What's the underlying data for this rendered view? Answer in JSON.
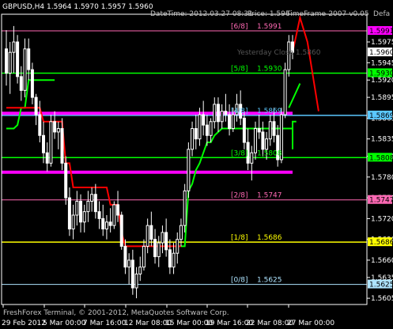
{
  "header": {
    "symbol_line": "GBPUSD,H4  1.5964 1.5970 1.5957 1.5960",
    "datetime": "DateTime: 2012.03.27 08:31",
    "price": "Price: 1.596",
    "indicator": "TimeFrame-2007-v0.05",
    "defa": "Defa"
  },
  "footer": {
    "copyright": "FreshForex Terminal, © 2001-2012, MetaQuotes Software Corp."
  },
  "colors": {
    "background": "#000000",
    "candle": "#ffffff",
    "grid": "#ffffff",
    "magenta": "#ff00ff",
    "green": "#00ff00",
    "yellow": "#ffff00",
    "pink": "#ff69b4",
    "cyan": "#5bc8ff",
    "red": "#ff0000",
    "sky": "#aee4ff",
    "silver": "#c0c0c0"
  },
  "chart_data": {
    "type": "candlestick",
    "symbol": "GBPUSD",
    "timeframe": "H4",
    "ylim": [
      1.5596,
      1.6015
    ],
    "y_ticks": [
      "1.5975",
      "1.5945",
      "1.5920",
      "1.5895",
      "1.5865",
      "1.5835",
      "1.5810",
      "1.5780",
      "1.5750",
      "1.5720",
      "1.5690",
      "1.5660",
      "1.5635",
      "1.5605"
    ],
    "x_ticks": [
      "29 Feb 2012",
      "5 Mar 00:00",
      "7 Mar 16:00",
      "12 Mar 08:00",
      "15 Mar 00:00",
      "19 Mar 16:00",
      "22 Mar 08:00",
      "27 Mar 00:00"
    ],
    "price_tags": [
      {
        "label": "1.5991",
        "color": "#ff00ff",
        "value": 1.5991
      },
      {
        "label": "1.5960",
        "color": "#ffffff",
        "value": 1.596
      },
      {
        "label": "1.5930",
        "color": "#00ff00",
        "value": 1.593
      },
      {
        "label": "1.5869",
        "color": "#5bc8ff",
        "value": 1.5869
      },
      {
        "label": "1.5808",
        "color": "#00ff00",
        "value": 1.5808
      },
      {
        "label": "1.5747",
        "color": "#ff69b4",
        "value": 1.5747
      },
      {
        "label": "1.5686",
        "color": "#ffff00",
        "value": 1.5686
      },
      {
        "label": "1.5625",
        "color": "#aee4ff",
        "value": 1.5625
      }
    ],
    "murrey_levels": [
      {
        "name": "[6/8]",
        "value": 1.5991,
        "value_label": "1.5991",
        "color": "#ff69b4",
        "width": 1
      },
      {
        "name": "[5/8]",
        "value": 1.593,
        "value_label": "1.5930",
        "color": "#00ff00",
        "width": 1.5
      },
      {
        "name": "[4/8]",
        "value": 1.5869,
        "value_label": "1.5869",
        "color": "#5bc8ff",
        "width": 1.5
      },
      {
        "name": "[3/8]",
        "value": 1.5808,
        "value_label": "1.5808",
        "color": "#00ff00",
        "width": 1.5
      },
      {
        "name": "[2/8]",
        "value": 1.5747,
        "value_label": "1.5747",
        "color": "#ff69b4",
        "width": 1
      },
      {
        "name": "[1/8]",
        "value": 1.5686,
        "value_label": "1.5686",
        "color": "#ffff00",
        "width": 1.5
      },
      {
        "name": "[0/8]",
        "value": 1.5625,
        "value_label": "1.5625",
        "color": "#aee4ff",
        "width": 1
      }
    ],
    "yesterday_close": {
      "label": "Yesterday Close 1.5860",
      "value": 1.596
    },
    "bands": [
      {
        "value": 1.5872,
        "color": "#ff00ff"
      },
      {
        "value": 1.5787,
        "color": "#ff00ff"
      }
    ],
    "candles": [
      [
        1.5965,
        1.5992,
        1.5912,
        1.593
      ],
      [
        1.593,
        1.5975,
        1.59,
        1.596
      ],
      [
        1.596,
        1.5998,
        1.593,
        1.5975
      ],
      [
        1.5975,
        1.5985,
        1.5915,
        1.5925
      ],
      [
        1.5925,
        1.594,
        1.589,
        1.5905
      ],
      [
        1.5905,
        1.598,
        1.5895,
        1.5965
      ],
      [
        1.5965,
        1.598,
        1.592,
        1.5935
      ],
      [
        1.5935,
        1.5945,
        1.5885,
        1.5895
      ],
      [
        1.5895,
        1.59,
        1.5855,
        1.587
      ],
      [
        1.587,
        1.589,
        1.583,
        1.584
      ],
      [
        1.584,
        1.586,
        1.58,
        1.5815
      ],
      [
        1.5815,
        1.583,
        1.5788,
        1.58
      ],
      [
        1.58,
        1.587,
        1.5795,
        1.586
      ],
      [
        1.586,
        1.5875,
        1.5835,
        1.5845
      ],
      [
        1.5845,
        1.586,
        1.582,
        1.585
      ],
      [
        1.585,
        1.5865,
        1.579,
        1.58
      ],
      [
        1.58,
        1.581,
        1.574,
        1.575
      ],
      [
        1.575,
        1.5765,
        1.5695,
        1.5705
      ],
      [
        1.5705,
        1.574,
        1.569,
        1.5725
      ],
      [
        1.5725,
        1.576,
        1.571,
        1.5745
      ],
      [
        1.5745,
        1.5755,
        1.57,
        1.5715
      ],
      [
        1.5715,
        1.574,
        1.57,
        1.573
      ],
      [
        1.573,
        1.576,
        1.5715,
        1.5745
      ],
      [
        1.5745,
        1.5765,
        1.573,
        1.5755
      ],
      [
        1.5755,
        1.577,
        1.572,
        1.573
      ],
      [
        1.573,
        1.5745,
        1.5705,
        1.572
      ],
      [
        1.572,
        1.574,
        1.5695,
        1.5705
      ],
      [
        1.5705,
        1.5725,
        1.569,
        1.5715
      ],
      [
        1.5715,
        1.5735,
        1.57,
        1.571
      ],
      [
        1.571,
        1.5745,
        1.5705,
        1.574
      ],
      [
        1.574,
        1.576,
        1.5715,
        1.5725
      ],
      [
        1.5725,
        1.573,
        1.5675,
        1.568
      ],
      [
        1.568,
        1.569,
        1.564,
        1.565
      ],
      [
        1.565,
        1.567,
        1.5625,
        1.566
      ],
      [
        1.566,
        1.5675,
        1.561,
        1.562
      ],
      [
        1.562,
        1.565,
        1.5605,
        1.564
      ],
      [
        1.564,
        1.5665,
        1.563,
        1.565
      ],
      [
        1.565,
        1.569,
        1.5645,
        1.568
      ],
      [
        1.568,
        1.572,
        1.567,
        1.571
      ],
      [
        1.571,
        1.573,
        1.568,
        1.569
      ],
      [
        1.569,
        1.5705,
        1.5655,
        1.5665
      ],
      [
        1.5665,
        1.5695,
        1.565,
        1.5685
      ],
      [
        1.5685,
        1.571,
        1.567,
        1.57
      ],
      [
        1.57,
        1.572,
        1.5665,
        1.5675
      ],
      [
        1.5675,
        1.569,
        1.564,
        1.565
      ],
      [
        1.565,
        1.5685,
        1.564,
        1.567
      ],
      [
        1.567,
        1.57,
        1.5655,
        1.569
      ],
      [
        1.569,
        1.572,
        1.568,
        1.571
      ],
      [
        1.571,
        1.577,
        1.57,
        1.576
      ],
      [
        1.576,
        1.583,
        1.575,
        1.582
      ],
      [
        1.582,
        1.586,
        1.581,
        1.585
      ],
      [
        1.585,
        1.587,
        1.582,
        1.5835
      ],
      [
        1.5835,
        1.588,
        1.5825,
        1.587
      ],
      [
        1.587,
        1.589,
        1.584,
        1.5855
      ],
      [
        1.5855,
        1.587,
        1.5825,
        1.584
      ],
      [
        1.584,
        1.5865,
        1.583,
        1.586
      ],
      [
        1.586,
        1.5895,
        1.585,
        1.5885
      ],
      [
        1.5885,
        1.5895,
        1.5845,
        1.586
      ],
      [
        1.586,
        1.5885,
        1.585,
        1.5875
      ],
      [
        1.5875,
        1.59,
        1.586,
        1.587
      ],
      [
        1.587,
        1.5885,
        1.584,
        1.585
      ],
      [
        1.585,
        1.588,
        1.5845,
        1.587
      ],
      [
        1.587,
        1.59,
        1.586,
        1.5885
      ],
      [
        1.5885,
        1.5905,
        1.5855,
        1.5865
      ],
      [
        1.5865,
        1.5875,
        1.582,
        1.583
      ],
      [
        1.583,
        1.585,
        1.579,
        1.58
      ],
      [
        1.58,
        1.5825,
        1.5775,
        1.5815
      ],
      [
        1.5815,
        1.586,
        1.5805,
        1.585
      ],
      [
        1.585,
        1.587,
        1.5835,
        1.5845
      ],
      [
        1.5845,
        1.586,
        1.581,
        1.582
      ],
      [
        1.582,
        1.5845,
        1.5805,
        1.5835
      ],
      [
        1.5835,
        1.587,
        1.5825,
        1.586
      ],
      [
        1.586,
        1.588,
        1.583,
        1.584
      ],
      [
        1.584,
        1.5855,
        1.5795,
        1.5805
      ],
      [
        1.5805,
        1.588,
        1.58,
        1.587
      ],
      [
        1.587,
        1.5945,
        1.5865,
        1.5935
      ],
      [
        1.5935,
        1.5985,
        1.5925,
        1.5975
      ],
      [
        1.5975,
        1.5985,
        1.595,
        1.596
      ]
    ],
    "red_line": [
      1.588,
      1.588,
      1.588,
      1.588,
      1.588,
      1.588,
      1.588,
      1.588,
      1.588,
      1.588,
      1.586,
      1.586,
      1.586,
      1.586,
      1.586,
      1.586,
      1.58,
      1.58,
      1.5765,
      1.5765,
      1.5765,
      1.5765,
      1.5765,
      1.5765,
      1.5765,
      1.5765,
      1.5765,
      1.5765,
      1.574,
      1.574,
      1.574,
      1.57,
      1.568,
      1.568,
      1.568,
      1.568,
      1.568,
      1.568,
      1.568,
      1.568,
      1.568,
      1.568,
      1.568,
      1.568,
      1.568,
      1.568,
      1.568,
      1.568,
      null,
      null,
      null,
      null,
      null,
      null,
      null,
      null,
      null,
      null,
      null,
      null,
      null,
      null,
      null,
      null,
      null,
      null,
      null,
      null,
      null,
      null,
      null,
      null,
      null,
      null,
      null,
      null,
      null,
      null
    ],
    "green_line": [
      1.585,
      1.585,
      1.585,
      1.5855,
      1.588,
      1.588,
      1.592,
      1.592,
      1.592,
      1.592,
      1.592,
      1.592,
      1.592,
      1.592,
      null,
      null,
      null,
      null,
      null,
      null,
      null,
      null,
      null,
      null,
      null,
      null,
      null,
      null,
      null,
      null,
      null,
      null,
      null,
      null,
      null,
      null,
      null,
      null,
      null,
      null,
      null,
      null,
      null,
      null,
      null,
      null,
      null,
      1.568,
      1.568,
      1.576,
      1.577,
      1.579,
      1.58,
      1.5815,
      1.583,
      1.583,
      1.584,
      1.5845,
      1.585,
      1.585,
      1.585,
      1.585,
      1.585,
      1.585,
      1.585,
      1.585,
      1.585,
      1.585,
      1.585,
      1.585,
      1.585,
      1.585,
      1.585,
      1.585,
      1.585,
      1.585,
      1.585,
      1.585
    ],
    "projection": {
      "color": "#ff0000",
      "points": [
        [
          77,
          1.596
        ],
        [
          79,
          1.601
        ],
        [
          81,
          1.5975
        ],
        [
          84,
          1.5875
        ]
      ]
    },
    "projection_green": {
      "color": "#00ff00",
      "points": [
        [
          77,
          1.582
        ],
        [
          77,
          1.586
        ],
        [
          78,
          1.586
        ]
      ]
    },
    "projection_green2": {
      "color": "#00ff00",
      "points": [
        [
          76,
          1.588
        ],
        [
          79,
          1.5915
        ]
      ]
    }
  }
}
